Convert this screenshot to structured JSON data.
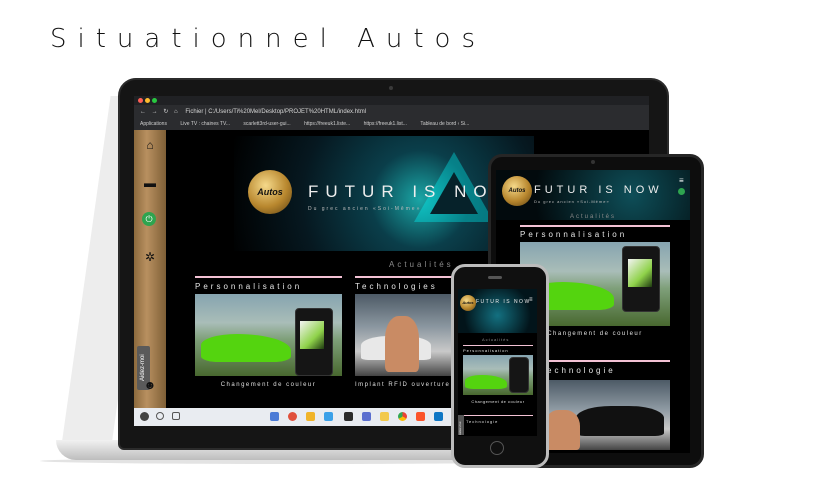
{
  "headline": "Situationnel Autos",
  "browser": {
    "address": "Fichier  |  C:/Users/Ti%20Mel/Desktop/PROJET%20HTML/index.html",
    "bookmarks": [
      "Applications",
      "Live TV : chaines TV...",
      "scarlett3rd-user-gui...",
      "https://freeuk1.liste...",
      "https://freeuk1.list...",
      "Tableau de bord ‹ Si..."
    ]
  },
  "site": {
    "logo_text": "Autos",
    "hero_title": "FUTUR IS NOW",
    "hero_subtitle": "Du grec ancien «Soi-Même»",
    "section_title": "Actualités",
    "help_tab": "Aidez-moi",
    "cards": [
      {
        "title": "Personnalisation",
        "caption": "Changement de couleur"
      },
      {
        "title": "Technologies",
        "caption": "Implant RFID ouverture démarrage"
      }
    ],
    "tablet_card2_title": "Technologie",
    "phone_card2_title": "Technologie"
  },
  "icons": {
    "sidebar": [
      "home-icon",
      "car-icon",
      "power-icon",
      "network-icon",
      "theater-mask-icon"
    ],
    "taskbar": [
      "start-icon",
      "search-icon",
      "task-view-icon",
      "folder-icon",
      "mail-icon",
      "store-icon",
      "app-icon",
      "photos-icon",
      "terminal-icon",
      "chrome-icon",
      "brave-icon",
      "code-icon"
    ]
  },
  "colors": {
    "accent_pink": "#f3c1d4",
    "neon": "#00ffff",
    "gold": "#b8872e"
  }
}
